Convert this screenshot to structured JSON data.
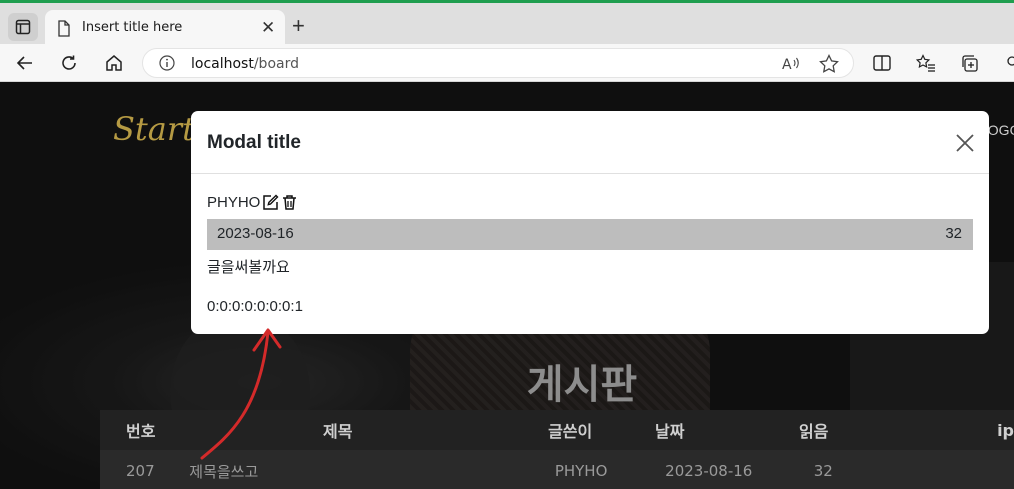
{
  "browser": {
    "tab_title": "Insert title here",
    "url_host": "localhost",
    "url_path": "/board"
  },
  "site": {
    "brand": "Start B",
    "nav_link": "LOGO"
  },
  "modal": {
    "title": "Modal title",
    "author": "PHYHO",
    "date": "2023-08-16",
    "views": "32",
    "content": "글을써볼까요",
    "ip": "0:0:0:0:0:0:0:1"
  },
  "board": {
    "title": "게시판",
    "columns": [
      "번호",
      "제목",
      "글쓴이",
      "날짜",
      "읽음",
      "ip"
    ],
    "rows": [
      {
        "no": "207",
        "subject": "제목을쓰고",
        "writer": "PHYHO",
        "date": "2023-08-16",
        "views": "32",
        "ip": ""
      }
    ]
  },
  "colors": {
    "accent_brand": "#b59a43",
    "annotation_arrow": "#d42a2a",
    "meta_bar": "#bdbdbd"
  }
}
